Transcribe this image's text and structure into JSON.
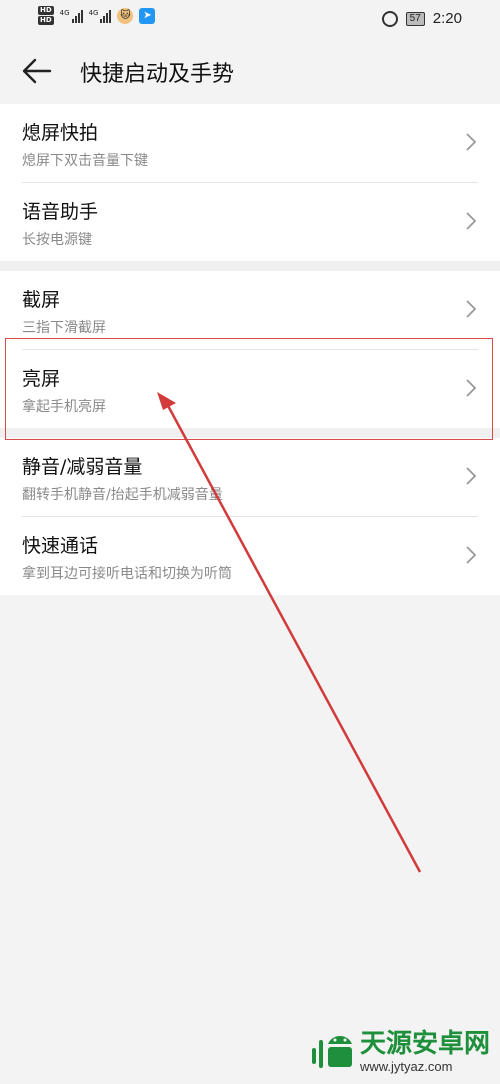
{
  "status_bar": {
    "hd_badges": [
      "HD",
      "HD"
    ],
    "net_labels": [
      "4G",
      "4G"
    ],
    "icons": [
      "hd-icon",
      "signal-4g-icon",
      "signal-4g-icon",
      "cat-app-icon",
      "blue-app-icon",
      "alarm-icon",
      "battery-icon"
    ],
    "battery": "57",
    "time": "2:20"
  },
  "header": {
    "back_icon": "arrow-left-icon",
    "title": "快捷启动及手势"
  },
  "groups": [
    {
      "items": [
        {
          "title": "熄屏快拍",
          "subtitle": "熄屏下双击音量下键"
        },
        {
          "title": "语音助手",
          "subtitle": "长按电源键"
        }
      ]
    },
    {
      "items": [
        {
          "title": "截屏",
          "subtitle": "三指下滑截屏"
        },
        {
          "title": "亮屏",
          "subtitle": "拿起手机亮屏"
        }
      ]
    },
    {
      "items": [
        {
          "title": "静音/减弱音量",
          "subtitle": "翻转手机静音/抬起手机减弱音量"
        },
        {
          "title": "快速通话",
          "subtitle": "拿到耳边可接听电话和切换为听筒"
        }
      ]
    }
  ],
  "annotation": {
    "highlight_color": "#d94a4a",
    "arrow_color": "#d13b3b"
  },
  "watermark": {
    "title": "天源安卓网",
    "url": "www.jytyaz.com"
  }
}
